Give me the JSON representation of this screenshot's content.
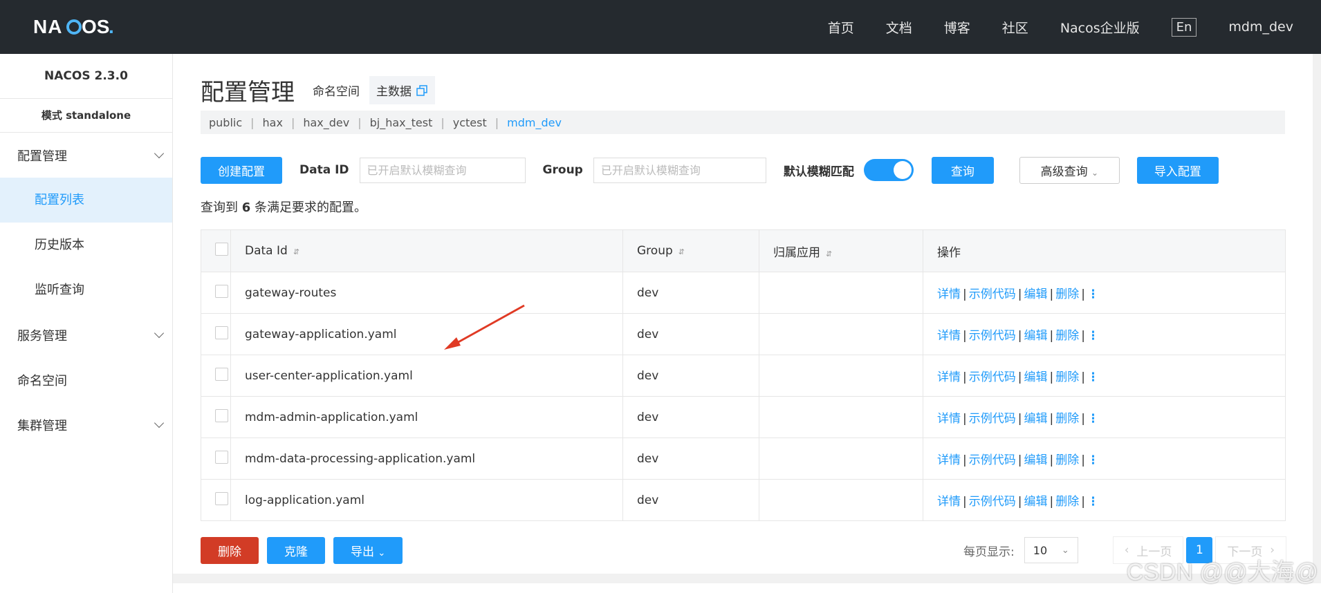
{
  "header": {
    "logo": "NACOS.",
    "nav": [
      "首页",
      "文档",
      "博客",
      "社区",
      "Nacos企业版"
    ],
    "lang": "En",
    "user": "mdm_dev"
  },
  "sidebar": {
    "version": "NACOS 2.3.0",
    "mode": "模式 standalone",
    "groups": [
      {
        "label": "配置管理",
        "items": [
          "配置列表",
          "历史版本",
          "监听查询"
        ]
      },
      {
        "label": "服务管理"
      },
      {
        "label": "命名空间"
      },
      {
        "label": "集群管理"
      }
    ]
  },
  "page": {
    "title": "配置管理",
    "ns_label": "命名空间",
    "ns_current": "主数据",
    "namespaces": [
      "public",
      "hax",
      "hax_dev",
      "bj_hax_test",
      "yctest",
      "mdm_dev"
    ]
  },
  "query": {
    "create": "创建配置",
    "dataid_label": "Data ID",
    "dataid_placeholder": "已开启默认模糊查询",
    "group_label": "Group",
    "group_placeholder": "已开启默认模糊查询",
    "fuzzy_label": "默认模糊匹配",
    "search": "查询",
    "advanced": "高级查询",
    "import": "导入配置"
  },
  "result": {
    "prefix": "查询到 ",
    "count": "6",
    "suffix": " 条满足要求的配置。"
  },
  "table": {
    "headers": [
      "Data Id",
      "Group",
      "归属应用",
      "操作"
    ],
    "rows": [
      {
        "dataid": "gateway-routes",
        "group": "dev",
        "app": ""
      },
      {
        "dataid": "gateway-application.yaml",
        "group": "dev",
        "app": ""
      },
      {
        "dataid": "user-center-application.yaml",
        "group": "dev",
        "app": ""
      },
      {
        "dataid": "mdm-admin-application.yaml",
        "group": "dev",
        "app": ""
      },
      {
        "dataid": "mdm-data-processing-application.yaml",
        "group": "dev",
        "app": ""
      },
      {
        "dataid": "log-application.yaml",
        "group": "dev",
        "app": ""
      }
    ],
    "ops": [
      "详情",
      "示例代码",
      "编辑",
      "删除"
    ]
  },
  "bottom": {
    "delete": "删除",
    "clone": "克隆",
    "export": "导出",
    "per_page_label": "每页显示:",
    "per_page": "10",
    "prev": "上一页",
    "page": "1",
    "next": "下一页"
  },
  "watermark": "CSDN @@大海@",
  "colors": {
    "primary": "#209bfa",
    "danger": "#d23c26",
    "header": "#252a2f"
  }
}
